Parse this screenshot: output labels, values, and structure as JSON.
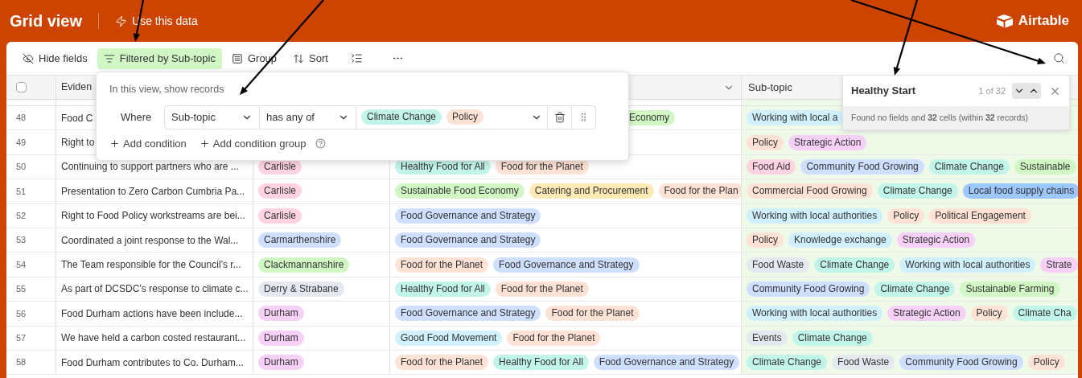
{
  "header": {
    "title": "Grid view",
    "action": "Use this data",
    "brand": "Airtable"
  },
  "toolbar": [
    {
      "kind": "hide",
      "label": "Hide fields",
      "active": false
    },
    {
      "kind": "filter",
      "label": "Filtered by Sub-topic",
      "active": true
    },
    {
      "kind": "group",
      "label": "Group",
      "active": false
    },
    {
      "kind": "sort",
      "label": "Sort",
      "active": false
    },
    {
      "kind": "row_height",
      "active": false
    },
    {
      "kind": "more",
      "active": false
    }
  ],
  "select_all": {
    "checked": false
  },
  "columns": {
    "evidence": "Eviden",
    "subtopic": "Sub-topic"
  },
  "rows": [
    {
      "num": "48",
      "covered": true,
      "evidence": "Food C",
      "theme": [
        {
          "label": "Economy",
          "color": "#d1f7c4"
        }
      ],
      "subtopics": [
        {
          "label": "Working with local a",
          "color": "#d0f0fd"
        }
      ]
    },
    {
      "num": "49",
      "evidence": "Right to",
      "subtopics": [
        {
          "label": "Policy",
          "color": "#fee2d5"
        },
        {
          "label": "Strategic Action",
          "color": "#f6d0f7"
        }
      ]
    },
    {
      "num": "50",
      "covered": false,
      "evidence": "Continuing to support partners who are ...",
      "authority": [
        {
          "label": "Carlisle",
          "color": "#ffd4e0"
        }
      ],
      "theme": [
        {
          "label": "Healthy Food for All",
          "color": "#c2f5e9"
        },
        {
          "label": "Food for the Planet",
          "color": "#fee2d5"
        }
      ],
      "subtopics": [
        {
          "label": "Food Aid",
          "color": "#ffd4e0"
        },
        {
          "label": "Community Food Growing",
          "color": "#cfdfff"
        },
        {
          "label": "Climate Change",
          "color": "#c2f5e9"
        },
        {
          "label": "Sustainable",
          "color": "#d1f7c4"
        }
      ]
    },
    {
      "num": "51",
      "covered": false,
      "evidence": "Presentation to Zero Carbon Cumbria Pa...",
      "authority": [
        {
          "label": "Carlisle",
          "color": "#ffd4e0"
        }
      ],
      "theme": [
        {
          "label": "Sustainable Food Economy",
          "color": "#d1f7c4"
        },
        {
          "label": "Catering and Procurement",
          "color": "#ffeab6"
        },
        {
          "label": "Food for the Plan",
          "color": "#fee2d5"
        }
      ],
      "subtopics": [
        {
          "label": "Commercial Food Growing",
          "color": "#fee2d5"
        },
        {
          "label": "Climate Change",
          "color": "#c2f5e9"
        },
        {
          "label": "Local food supply chains",
          "color": "#9cc7ff"
        }
      ]
    },
    {
      "num": "52",
      "covered": false,
      "evidence": "Right to Food Policy workstreams are bei...",
      "authority": [
        {
          "label": "Carlisle",
          "color": "#ffd4e0"
        }
      ],
      "theme": [
        {
          "label": "Food Governance and Strategy",
          "color": "#cfdfff"
        }
      ],
      "subtopics": [
        {
          "label": "Working with local authorities",
          "color": "#d0f0fd"
        },
        {
          "label": "Policy",
          "color": "#fee2d5"
        },
        {
          "label": "Political Engagement",
          "color": "#fee2d5"
        }
      ]
    },
    {
      "num": "53",
      "covered": false,
      "evidence": "Coordinated a joint response to the Wal...",
      "authority": [
        {
          "label": "Carmarthenshire",
          "color": "#cfdfff"
        }
      ],
      "theme": [
        {
          "label": "Food Governance and Strategy",
          "color": "#cfdfff"
        }
      ],
      "subtopics": [
        {
          "label": "Policy",
          "color": "#fee2d5"
        },
        {
          "label": "Knowledge exchange",
          "color": "#d0f0fd"
        },
        {
          "label": "Strategic Action",
          "color": "#f6d0f7"
        }
      ]
    },
    {
      "num": "54",
      "covered": false,
      "evidence": "The Team responsible for the Council’s r...",
      "authority": [
        {
          "label": "Clackmannanshire",
          "color": "#d1f7c4"
        }
      ],
      "theme": [
        {
          "label": "Food for the Planet",
          "color": "#fee2d5"
        },
        {
          "label": "Food Governance and Strategy",
          "color": "#cfdfff"
        }
      ],
      "subtopics": [
        {
          "label": "Food Waste",
          "color": "#e4e9f0"
        },
        {
          "label": "Climate Change",
          "color": "#c2f5e9"
        },
        {
          "label": "Working with local authorities",
          "color": "#d0f0fd"
        },
        {
          "label": "Strate",
          "color": "#f6d0f7"
        }
      ]
    },
    {
      "num": "55",
      "covered": false,
      "evidence": "As part of DCSDC’s response to climate c...",
      "authority": [
        {
          "label": "Derry & Strabane",
          "color": "#e4e9f0"
        }
      ],
      "theme": [
        {
          "label": "Healthy Food for All",
          "color": "#c2f5e9"
        },
        {
          "label": "Food for the Planet",
          "color": "#fee2d5"
        }
      ],
      "subtopics": [
        {
          "label": "Community Food Growing",
          "color": "#cfdfff"
        },
        {
          "label": "Climate Change",
          "color": "#c2f5e9"
        },
        {
          "label": "Sustainable Farming",
          "color": "#d1f7c4"
        }
      ]
    },
    {
      "num": "56",
      "covered": false,
      "evidence": "Food Durham actions have been include...",
      "authority": [
        {
          "label": "Durham",
          "color": "#f6d0f7"
        }
      ],
      "theme": [
        {
          "label": "Food Governance and Strategy",
          "color": "#cfdfff"
        },
        {
          "label": "Food for the Planet",
          "color": "#fee2d5"
        }
      ],
      "subtopics": [
        {
          "label": "Working with local authorities",
          "color": "#d0f0fd"
        },
        {
          "label": "Strategic Action",
          "color": "#f6d0f7"
        },
        {
          "label": "Policy",
          "color": "#fee2d5"
        },
        {
          "label": "Climate Cha",
          "color": "#c2f5e9"
        }
      ]
    },
    {
      "num": "57",
      "covered": false,
      "evidence": "We have held a carbon costed restaurant...",
      "authority": [
        {
          "label": "Durham",
          "color": "#f6d0f7"
        }
      ],
      "theme": [
        {
          "label": "Good Food Movement",
          "color": "#d0f0fd"
        },
        {
          "label": "Food for the Planet",
          "color": "#fee2d5"
        }
      ],
      "subtopics": [
        {
          "label": "Events",
          "color": "#e4e9f0"
        },
        {
          "label": "Climate Change",
          "color": "#c2f5e9"
        }
      ]
    },
    {
      "num": "58",
      "covered": false,
      "evidence": "Food Durham contributes to Co. Durham...",
      "authority": [
        {
          "label": "Durham",
          "color": "#f6d0f7"
        }
      ],
      "theme": [
        {
          "label": "Food for the Planet",
          "color": "#fee2d5"
        },
        {
          "label": "Healthy Food for All",
          "color": "#c2f5e9"
        },
        {
          "label": "Food Governance and Strategy",
          "color": "#cfdfff"
        }
      ],
      "subtopics": [
        {
          "label": "Climate Change",
          "color": "#c2f5e9"
        },
        {
          "label": "Food Waste",
          "color": "#e4e9f0"
        },
        {
          "label": "Community Food Growing",
          "color": "#cfdfff"
        },
        {
          "label": "Policy",
          "color": "#fee2d5"
        }
      ]
    }
  ],
  "filter": {
    "intro": "In this view, show records",
    "where": "Where",
    "field": "Sub-topic",
    "operator": "has any of",
    "values": [
      {
        "label": "Climate Change",
        "color": "#c2f5e9"
      },
      {
        "label": "Policy",
        "color": "#fee2d5"
      }
    ],
    "add_condition": "Add condition",
    "add_group": "Add condition group"
  },
  "search": {
    "value": "Healthy Start",
    "count": "1 of 32",
    "result": "Found no fields and **32** cells (within **32** records)"
  }
}
